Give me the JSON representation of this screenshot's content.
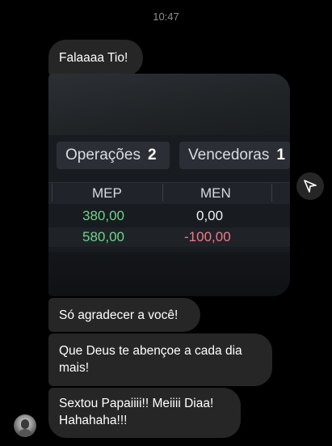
{
  "status": {
    "time": "10:47"
  },
  "messages": [
    {
      "text": "Falaaaa Tio!"
    },
    {
      "text": "Só agradecer a você!"
    },
    {
      "text": "Que Deus te abençoe a cada dia mais!"
    },
    {
      "text": "Sextou Papaiiii!! Meiiii Diaa! Hahahaha!!!"
    }
  ],
  "photo": {
    "tabs": [
      {
        "label": "Operações",
        "count": "2"
      },
      {
        "label": "Vencedoras",
        "count": "1"
      }
    ],
    "columns": [
      "MEP",
      "MEN"
    ],
    "rows": [
      {
        "mep": "380,00",
        "men": "0,00"
      },
      {
        "mep": "580,00",
        "men": "-100,00"
      }
    ],
    "colors": {
      "positive": "#6fd48a",
      "negative": "#f07a86",
      "neutral": "#eef0f3"
    }
  },
  "icons": {
    "share": "send-icon",
    "avatar": "avatar"
  }
}
